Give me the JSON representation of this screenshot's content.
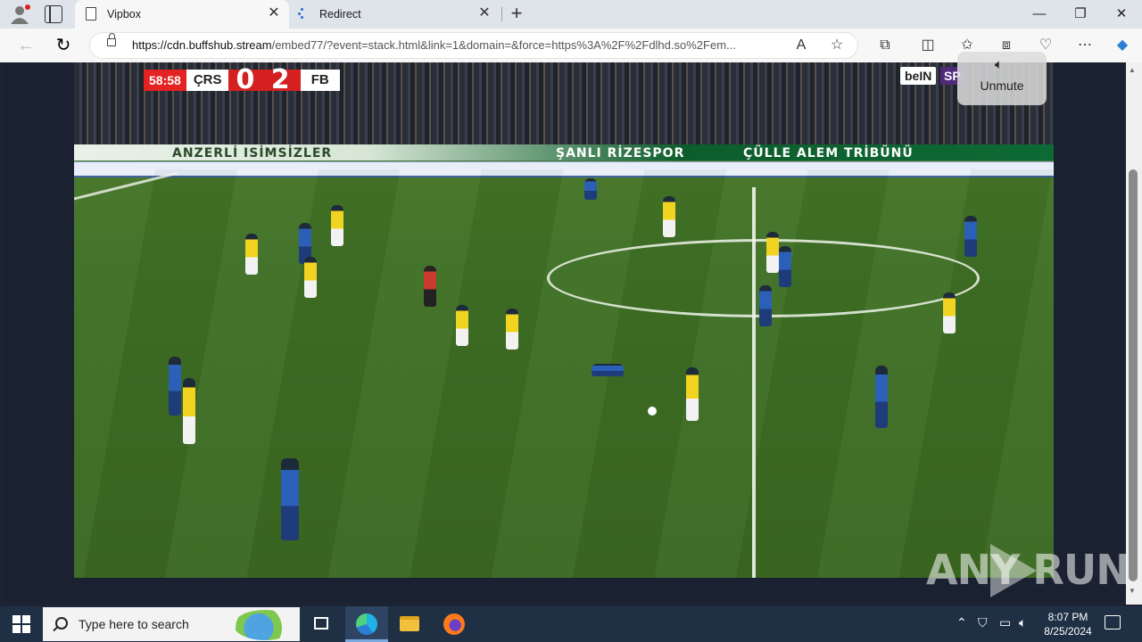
{
  "browser": {
    "tabs": [
      {
        "title": "Vipbox",
        "active": true
      },
      {
        "title": "Redirect",
        "active": false
      }
    ],
    "url_host": "https://cdn.buffshub.stream",
    "url_rest": "/embed77/?event=stack.html&link=1&domain=&force=https%3A%2F%2Fdlhd.so%2Fem...",
    "window_controls": {
      "minimize": "—",
      "restore": "❐",
      "close": "✕"
    }
  },
  "video": {
    "scoreboard": {
      "time": "58:58",
      "home": "ÇRS",
      "score": "0 2",
      "away": "FB"
    },
    "broadcaster": "beIN",
    "broadcaster_suffix": "SP",
    "banners": [
      "ANZERLİ  ISİMSİZLER",
      "ŞANLI  RİZESPOR",
      "ÇÜLLE  ALEM  TRİBÜNÜ"
    ],
    "unmute_label": "Unmute",
    "watermark": "ANY    RUN"
  },
  "taskbar": {
    "search_placeholder": "Type here to search",
    "time": "8:07 PM",
    "date": "8/25/2024"
  },
  "colors": {
    "accent": "#2b7fd3",
    "score_red": "#d42020",
    "taskbar": "#1f2f44"
  }
}
